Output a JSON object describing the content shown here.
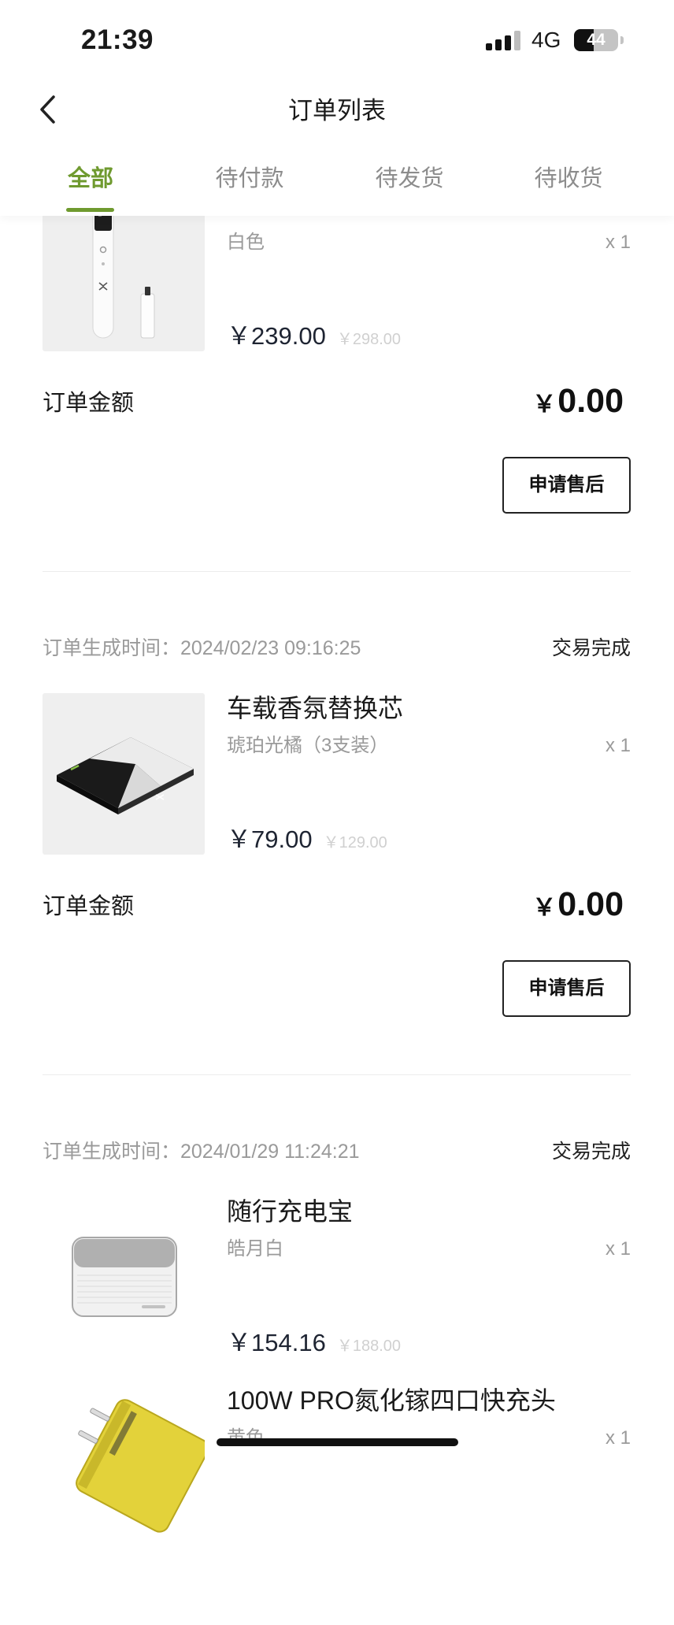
{
  "status_bar": {
    "time": "21:39",
    "network": "4G",
    "battery": "44"
  },
  "nav": {
    "title": "订单列表",
    "back_icon": "chevron-left-icon"
  },
  "colors": {
    "accent": "#6f9a2f"
  },
  "tabs": [
    {
      "label": "全部",
      "active": true
    },
    {
      "label": "待付款",
      "active": false
    },
    {
      "label": "待发货",
      "active": false
    },
    {
      "label": "待收货",
      "active": false
    }
  ],
  "orders": [
    {
      "items": [
        {
          "spec": "白色",
          "qty": "x 1",
          "price": "￥239.00",
          "original_price": "￥298.00"
        }
      ],
      "amount_label": "订单金额",
      "amount_currency": "￥",
      "amount_value": "0.00",
      "action_label": "申请售后"
    },
    {
      "created": "订单生成时间：2024/02/23 09:16:25",
      "status": "交易完成",
      "items": [
        {
          "name": "车载香氛替换芯",
          "spec": "琥珀光橘（3支装）",
          "qty": "x 1",
          "price": "￥79.00",
          "original_price": "￥129.00"
        }
      ],
      "amount_label": "订单金额",
      "amount_currency": "￥",
      "amount_value": "0.00",
      "action_label": "申请售后"
    },
    {
      "created": "订单生成时间：2024/01/29 11:24:21",
      "status": "交易完成",
      "items": [
        {
          "name": "随行充电宝",
          "spec": "皓月白",
          "qty": "x 1",
          "price": "￥154.16",
          "original_price": "￥188.00"
        },
        {
          "name": "100W PRO氮化镓四口快充头",
          "spec": "黄色",
          "qty": "x 1"
        }
      ]
    }
  ]
}
